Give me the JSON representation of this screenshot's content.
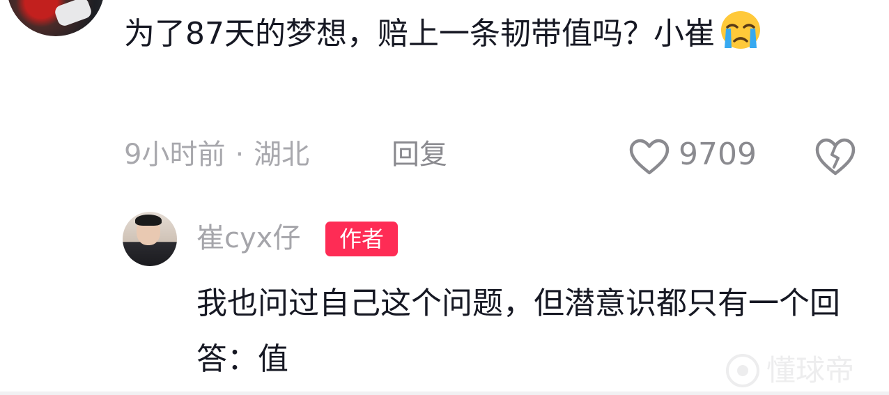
{
  "comment": {
    "text": "为了87天的梦想，赔上一条韧带值吗？小崔",
    "emoji": "loudly-crying-face",
    "time": "9小时前",
    "separator": "·",
    "location": "湖北",
    "reply_label": "回复",
    "like_count": "9709"
  },
  "reply": {
    "author": "崔cyx仔",
    "author_tag": "作者",
    "text": "我也问过自己这个问题，但潜意识都只有一个回答：值"
  },
  "watermark": {
    "text": "懂球帝"
  },
  "colors": {
    "author_tag_bg": "#fe2c55",
    "meta_text": "#a8a8ad",
    "body_text": "#161823"
  }
}
